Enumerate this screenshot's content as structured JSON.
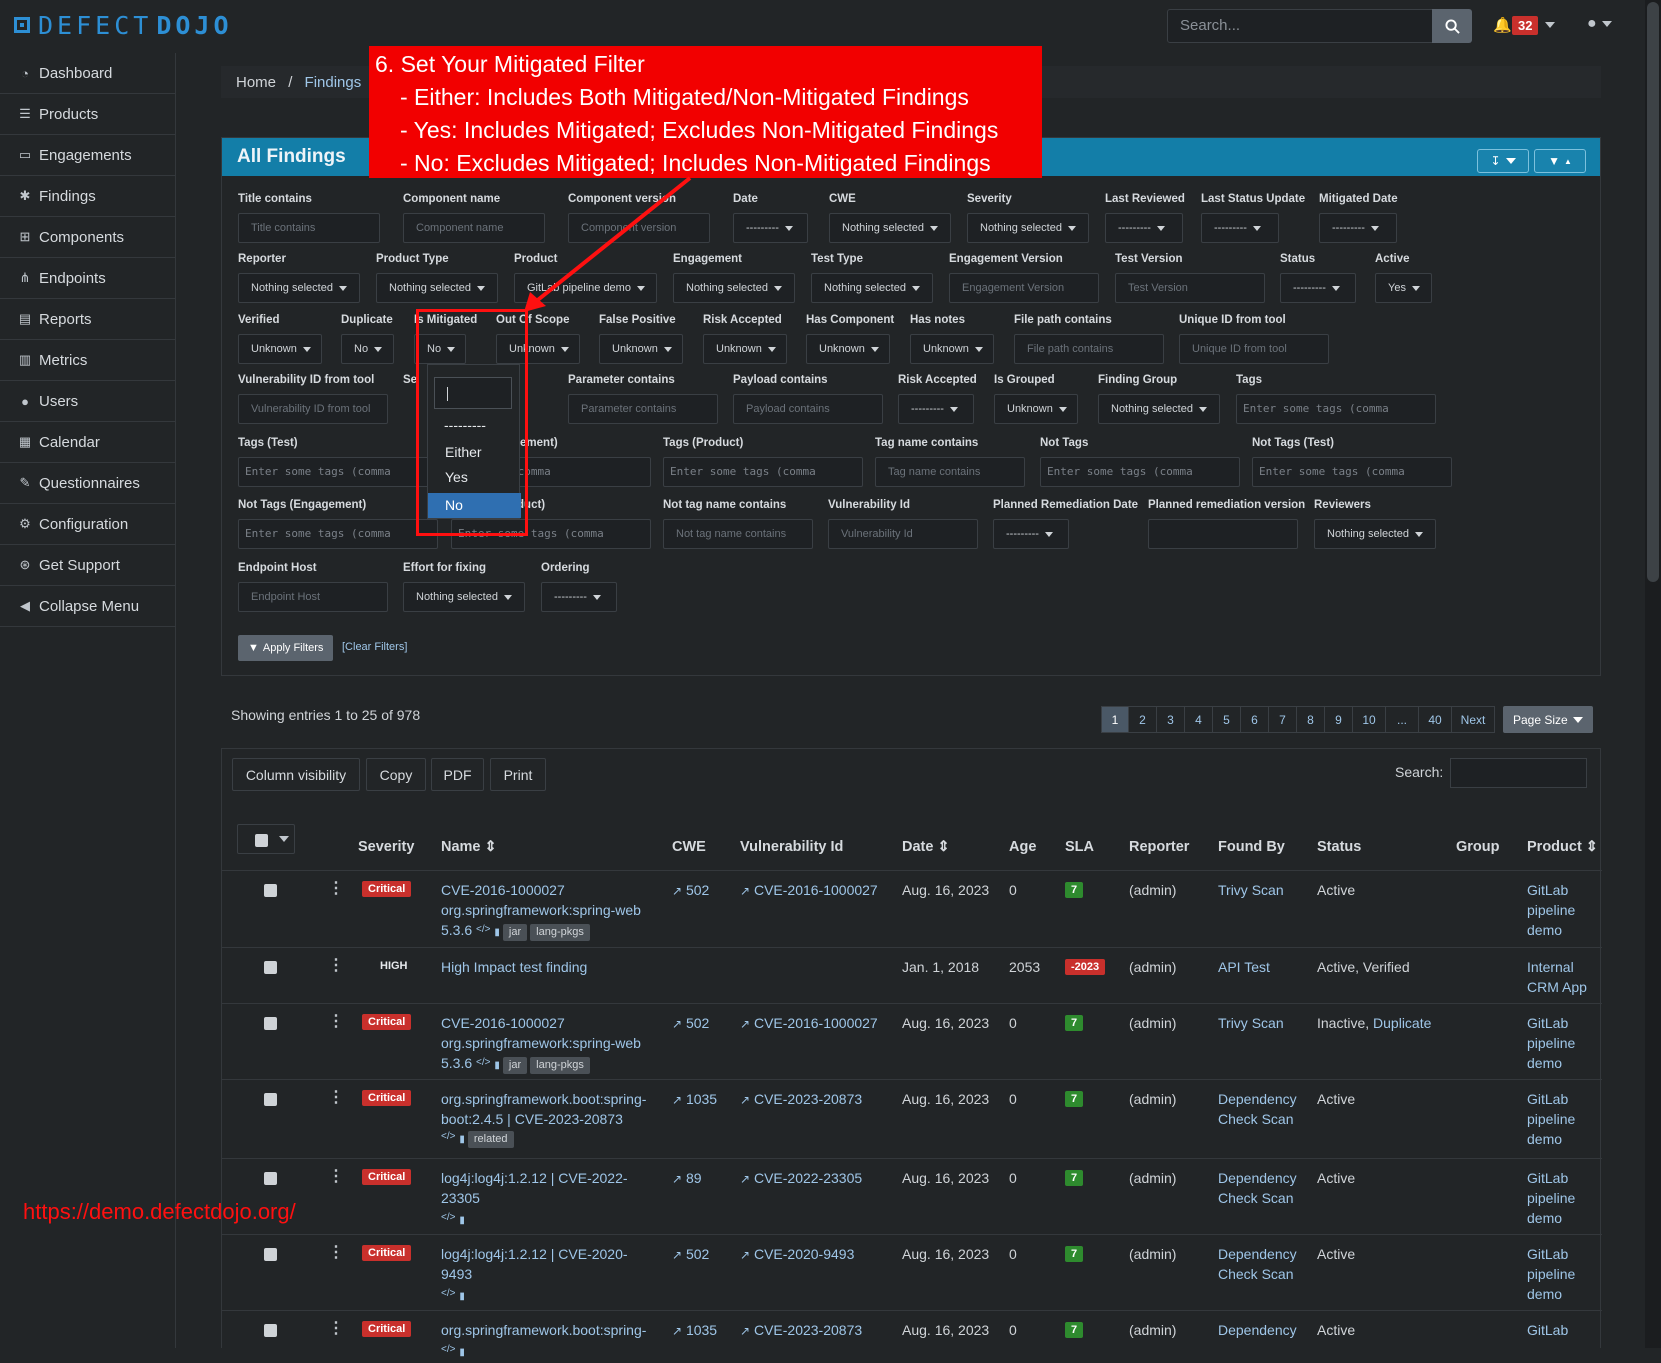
{
  "app": {
    "name_part1": "DEFECT",
    "name_part2": "DOJO"
  },
  "topbar": {
    "search_placeholder": "Search...",
    "notification_count": "32"
  },
  "sidebar": {
    "items": [
      {
        "label": "Dashboard",
        "icon": "dashboard-icon",
        "glyph": "◔"
      },
      {
        "label": "Products",
        "icon": "list-icon",
        "glyph": "☰"
      },
      {
        "label": "Engagements",
        "icon": "inbox-icon",
        "glyph": "▭"
      },
      {
        "label": "Findings",
        "icon": "bug-icon",
        "glyph": "✱"
      },
      {
        "label": "Components",
        "icon": "table-icon",
        "glyph": "⊞"
      },
      {
        "label": "Endpoints",
        "icon": "sitemap-icon",
        "glyph": "⋔"
      },
      {
        "label": "Reports",
        "icon": "file-icon",
        "glyph": "▤"
      },
      {
        "label": "Metrics",
        "icon": "chart-icon",
        "glyph": "▥"
      },
      {
        "label": "Users",
        "icon": "user-icon",
        "glyph": "●"
      },
      {
        "label": "Calendar",
        "icon": "calendar-icon",
        "glyph": "▦"
      },
      {
        "label": "Questionnaires",
        "icon": "comments-icon",
        "glyph": "✎"
      },
      {
        "label": "Configuration",
        "icon": "gear-icon",
        "glyph": "⚙"
      },
      {
        "label": "Get Support",
        "icon": "support-icon",
        "glyph": "⊛"
      },
      {
        "label": "Collapse Menu",
        "icon": "collapse-icon",
        "glyph": "◀"
      }
    ]
  },
  "breadcrumb": {
    "home": "Home",
    "sep": "/",
    "current": "Findings"
  },
  "callout": {
    "title": "6. Set Your Mitigated Filter",
    "line1": "- Either: Includes Both Mitigated/Non-Mitigated Findings",
    "line2": "- Yes: Includes Mitigated; Excludes Non-Mitigated Findings",
    "line3": "- No: Excludes Mitigated; Includes Non-Mitigated Findings"
  },
  "panel": {
    "title": "All Findings"
  },
  "filters": {
    "title_contains": {
      "label": "Title contains",
      "placeholder": "Title contains"
    },
    "component_name": {
      "label": "Component name",
      "placeholder": "Component name"
    },
    "component_version": {
      "label": "Component version",
      "placeholder": "Component version"
    },
    "date": {
      "label": "Date",
      "value": "---------"
    },
    "cwe": {
      "label": "CWE",
      "value": "Nothing selected"
    },
    "severity": {
      "label": "Severity",
      "value": "Nothing selected"
    },
    "last_reviewed": {
      "label": "Last Reviewed",
      "value": "---------"
    },
    "last_status_update": {
      "label": "Last Status Update",
      "value": "---------"
    },
    "mitigated_date": {
      "label": "Mitigated Date",
      "value": "---------"
    },
    "reporter": {
      "label": "Reporter",
      "value": "Nothing selected"
    },
    "product_type": {
      "label": "Product Type",
      "value": "Nothing selected"
    },
    "product": {
      "label": "Product",
      "value": "GitLab pipeline demo"
    },
    "engagement": {
      "label": "Engagement",
      "value": "Nothing selected"
    },
    "test_type": {
      "label": "Test Type",
      "value": "Nothing selected"
    },
    "engagement_version": {
      "label": "Engagement Version",
      "placeholder": "Engagement Version"
    },
    "test_version": {
      "label": "Test Version",
      "placeholder": "Test Version"
    },
    "status": {
      "label": "Status",
      "value": "---------"
    },
    "active": {
      "label": "Active",
      "value": "Yes"
    },
    "verified": {
      "label": "Verified",
      "value": "Unknown"
    },
    "duplicate": {
      "label": "Duplicate",
      "value": "No"
    },
    "is_mitigated": {
      "label": "Is Mitigated",
      "value": "No"
    },
    "out_of_scope": {
      "label": "Out Of Scope",
      "value": "Unknown"
    },
    "false_positive": {
      "label": "False Positive",
      "value": "Unknown"
    },
    "risk_accepted": {
      "label": "Risk Accepted",
      "value": "Unknown"
    },
    "has_component": {
      "label": "Has Component",
      "value": "Unknown"
    },
    "has_notes": {
      "label": "Has notes",
      "value": "Unknown"
    },
    "file_path": {
      "label": "File path contains",
      "placeholder": "File path contains"
    },
    "unique_id": {
      "label": "Unique ID from tool",
      "placeholder": "Unique ID from tool"
    },
    "vuln_id_tool": {
      "label": "Vulnerability ID from tool",
      "placeholder": "Vulnerability ID from tool"
    },
    "service_partial": {
      "label": "Se"
    },
    "parameter": {
      "label": "Parameter contains",
      "placeholder": "Parameter contains"
    },
    "payload": {
      "label": "Payload contains",
      "placeholder": "Payload contains"
    },
    "risk_accepted2": {
      "label": "Risk Accepted",
      "value": "---------"
    },
    "is_grouped": {
      "label": "Is Grouped",
      "value": "Unknown"
    },
    "finding_group": {
      "label": "Finding Group",
      "value": "Nothing selected"
    },
    "tags": {
      "label": "Tags",
      "placeholder": "Enter some tags (comma"
    },
    "tags_test": {
      "label": "Tags (Test)",
      "placeholder": "Enter some tags (comma"
    },
    "tags_engagement": {
      "label": "gement)",
      "placeholder": "me tags (comma"
    },
    "tags_product": {
      "label": "Tags (Product)",
      "placeholder": "Enter some tags (comma"
    },
    "tag_name": {
      "label": "Tag name contains",
      "placeholder": "Tag name contains"
    },
    "not_tags": {
      "label": "Not Tags",
      "placeholder": "Enter some tags (comma"
    },
    "not_tags_test": {
      "label": "Not Tags (Test)",
      "placeholder": "Enter some tags (comma"
    },
    "not_tags_engagement": {
      "label": "Not Tags (Engagement)",
      "placeholder": "Enter some tags (comma"
    },
    "not_tags_product": {
      "label": "oduct)",
      "placeholder": "Enter some tags (comma"
    },
    "not_tag_name": {
      "label": "Not tag name contains",
      "placeholder": "Not tag name contains"
    },
    "vulnerability_id": {
      "label": "Vulnerability Id",
      "placeholder": "Vulnerability Id"
    },
    "planned_remediation_date": {
      "label": "Planned Remediation Date",
      "value": "---------"
    },
    "planned_remediation_version": {
      "label": "Planned remediation version"
    },
    "reviewers": {
      "label": "Reviewers",
      "value": "Nothing selected"
    },
    "endpoint_host": {
      "label": "Endpoint Host",
      "placeholder": "Endpoint Host"
    },
    "effort": {
      "label": "Effort for fixing",
      "value": "Nothing selected"
    },
    "ordering": {
      "label": "Ordering",
      "value": "---------"
    },
    "apply": "Apply Filters",
    "clear": "[Clear Filters]"
  },
  "dropdown": {
    "options": [
      "---------",
      "Either",
      "Yes",
      "No"
    ],
    "selected": "No"
  },
  "listing": {
    "entries": "Showing entries 1 to 25 of 978",
    "pages": [
      "1",
      "2",
      "3",
      "4",
      "5",
      "6",
      "7",
      "8",
      "9",
      "10",
      "...",
      "40",
      "Next"
    ],
    "page_size": "Page Size",
    "buttons": [
      "Column visibility",
      "Copy",
      "PDF",
      "Print"
    ],
    "search_label": "Search:"
  },
  "table": {
    "headers": {
      "severity": "Severity",
      "name": "Name",
      "cwe": "CWE",
      "vuln": "Vulnerability Id",
      "date": "Date",
      "age": "Age",
      "sla": "SLA",
      "reporter": "Reporter",
      "found_by": "Found By",
      "status": "Status",
      "group": "Group",
      "product": "Product"
    },
    "rows": [
      {
        "severity": "Critical",
        "name1": "CVE-2016-1000027",
        "name2": "org.springframework:spring-web",
        "name3": "5.3.6",
        "tags": [
          "jar",
          "lang-pkgs"
        ],
        "cwe": "502",
        "vuln": "CVE-2016-1000027",
        "date": "Aug. 16, 2023",
        "age": "0",
        "sla": "7",
        "reporter": "(admin)",
        "found1": "Trivy Scan",
        "found2": "",
        "status": "Active",
        "status2": "",
        "prod1": "GitLab",
        "prod2": "pipeline",
        "prod3": "demo"
      },
      {
        "severity": "HIGH",
        "name1": "High Impact test finding",
        "name2": "",
        "name3": "",
        "tags": [],
        "cwe": "",
        "vuln": "",
        "date": "Jan. 1, 2018",
        "age": "2053",
        "sla": "-2023",
        "reporter": "(admin)",
        "found1": "API Test",
        "found2": "",
        "status": "Active, Verified",
        "status2": "",
        "prod1": "Internal",
        "prod2": "CRM App",
        "prod3": ""
      },
      {
        "severity": "Critical",
        "name1": "CVE-2016-1000027",
        "name2": "org.springframework:spring-web",
        "name3": "5.3.6",
        "tags": [
          "jar",
          "lang-pkgs"
        ],
        "cwe": "502",
        "vuln": "CVE-2016-1000027",
        "date": "Aug. 16, 2023",
        "age": "0",
        "sla": "7",
        "reporter": "(admin)",
        "found1": "Trivy Scan",
        "found2": "",
        "status": "Inactive,",
        "status2": "Duplicate",
        "prod1": "GitLab",
        "prod2": "pipeline",
        "prod3": "demo"
      },
      {
        "severity": "Critical",
        "name1": "org.springframework.boot:spring-",
        "name2": "boot:2.4.5 | CVE-2023-20873",
        "name3": "",
        "tags": [
          "related"
        ],
        "cwe": "1035",
        "vuln": "CVE-2023-20873",
        "date": "Aug. 16, 2023",
        "age": "0",
        "sla": "7",
        "reporter": "(admin)",
        "found1": "Dependency",
        "found2": "Check Scan",
        "status": "Active",
        "status2": "",
        "prod1": "GitLab",
        "prod2": "pipeline",
        "prod3": "demo"
      },
      {
        "severity": "Critical",
        "name1": "log4j:log4j:1.2.12 | CVE-2022-",
        "name2": "23305",
        "name3": "",
        "tags": [],
        "cwe": "89",
        "vuln": "CVE-2022-23305",
        "date": "Aug. 16, 2023",
        "age": "0",
        "sla": "7",
        "reporter": "(admin)",
        "found1": "Dependency",
        "found2": "Check Scan",
        "status": "Active",
        "status2": "",
        "prod1": "GitLab",
        "prod2": "pipeline",
        "prod3": "demo"
      },
      {
        "severity": "Critical",
        "name1": "log4j:log4j:1.2.12 | CVE-2020-",
        "name2": "9493",
        "name3": "",
        "tags": [],
        "cwe": "502",
        "vuln": "CVE-2020-9493",
        "date": "Aug. 16, 2023",
        "age": "0",
        "sla": "7",
        "reporter": "(admin)",
        "found1": "Dependency",
        "found2": "Check Scan",
        "status": "Active",
        "status2": "",
        "prod1": "GitLab",
        "prod2": "pipeline",
        "prod3": "demo"
      },
      {
        "severity": "Critical",
        "name1": "org.springframework.boot:spring-",
        "name2": "",
        "name3": "",
        "tags": [],
        "cwe": "1035",
        "vuln": "CVE-2023-20873",
        "date": "Aug. 16, 2023",
        "age": "0",
        "sla": "7",
        "reporter": "(admin)",
        "found1": "Dependency",
        "found2": "",
        "status": "Active",
        "status2": "",
        "prod1": "GitLab",
        "prod2": "",
        "prod3": ""
      }
    ]
  },
  "watermark": "https://demo.defectdojo.org/"
}
